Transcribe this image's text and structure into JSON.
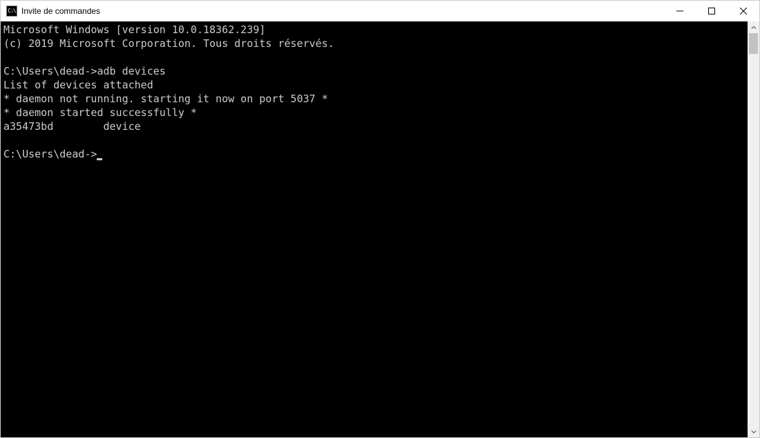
{
  "window": {
    "title": "Invite de commandes",
    "icon_label": "C:\\"
  },
  "terminal": {
    "lines": [
      "Microsoft Windows [version 10.0.18362.239]",
      "(c) 2019 Microsoft Corporation. Tous droits réservés.",
      "",
      "C:\\Users\\dead->adb devices",
      "List of devices attached",
      "* daemon not running. starting it now on port 5037 *",
      "* daemon started successfully *",
      "a35473bd        device",
      "",
      "C:\\Users\\dead->"
    ]
  }
}
